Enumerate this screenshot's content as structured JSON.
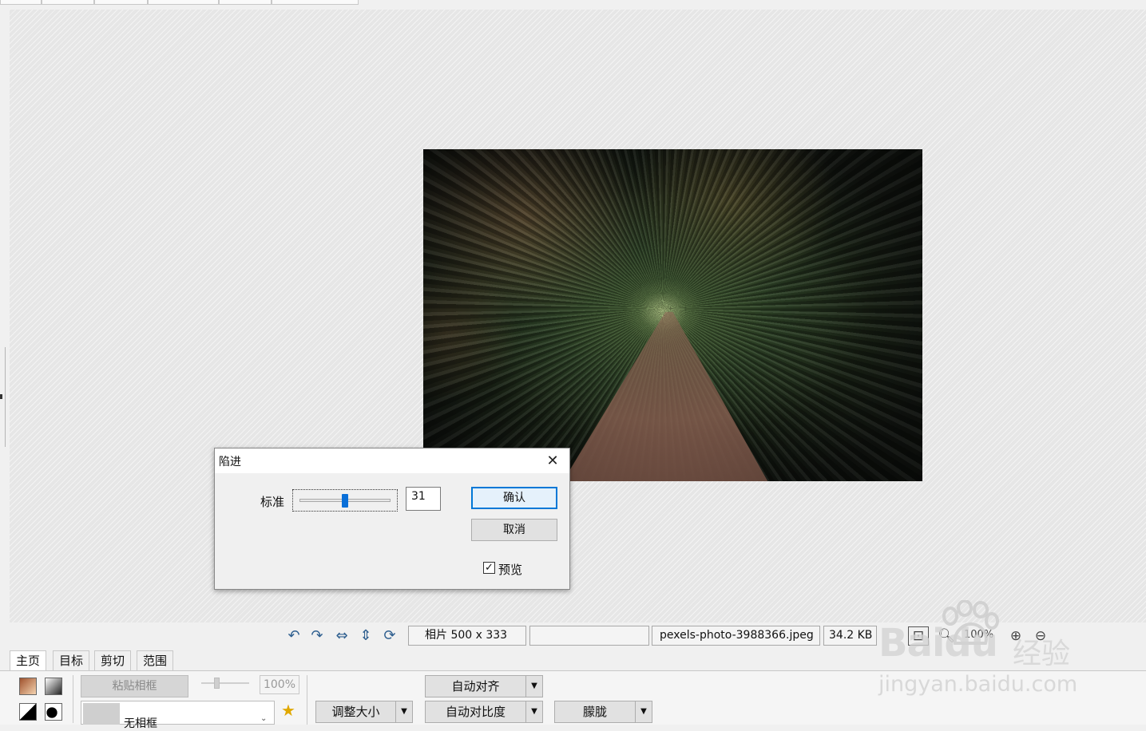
{
  "dialog": {
    "title": "陷进",
    "close_glyph": "✕",
    "slider_label": "标准",
    "slider_value": "31",
    "slider_fraction": 0.5,
    "ok_label": "确认",
    "cancel_label": "取消",
    "preview_label": "预览",
    "preview_checked": true
  },
  "statusbar": {
    "image_info": "相片 500 x 333",
    "empty_field": "",
    "filename": "pexels-photo-3988366.jpeg",
    "filesize": "34.2 KB",
    "zoom": "100%"
  },
  "ribbon": {
    "tabs": [
      "主页",
      "目标",
      "剪切",
      "范围"
    ],
    "active_tab": "主页",
    "paste_frame_label": "粘贴相框",
    "opacity_value": "100%",
    "frame_select_value": "无相框",
    "resize_label": "调整大小",
    "auto_align_label": "自动对齐",
    "auto_contrast_label": "自动对比度",
    "blur_label": "朦胧"
  },
  "icons": {
    "undo": "undo-icon",
    "redo": "redo-icon",
    "fit": "fit-width-icon",
    "fit_height": "fit-height-icon",
    "rotate": "rotate-icon",
    "star": "star-icon"
  },
  "colors": {
    "accent": "#0078d7",
    "slider_thumb": "#0a6fd8"
  },
  "watermark": {
    "brand": "Baidu",
    "brand_cn": "经验",
    "url": "jingyan.baidu.com"
  }
}
